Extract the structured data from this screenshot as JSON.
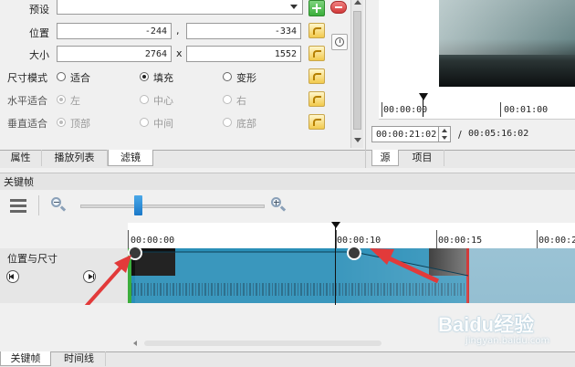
{
  "filter_panel": {
    "preset_label": "预设",
    "position_label": "位置",
    "position_x": "-244",
    "position_sep": ",",
    "position_y": "-334",
    "size_label": "大小",
    "size_w": "2764",
    "size_sep": "x",
    "size_h": "1552",
    "size_mode_label": "尺寸模式",
    "size_mode_options": [
      "适合",
      "填充",
      "变形"
    ],
    "size_mode_selected": "填充",
    "h_fit_label": "水平适合",
    "h_fit_options": [
      "左",
      "中心",
      "右"
    ],
    "v_fit_label": "垂直适合",
    "v_fit_options": [
      "顶部",
      "中间",
      "底部"
    ]
  },
  "left_tabs": [
    "属性",
    "播放列表",
    "滤镜"
  ],
  "left_tabs_active": "滤镜",
  "player": {
    "ruler_ticks": [
      "00:00:00",
      "00:01:00"
    ],
    "current_time": "00:00:21:02",
    "time_sep": "/",
    "total_time": "00:05:16:02",
    "tabs": [
      "源",
      "项目"
    ],
    "active_tab": "源"
  },
  "keyframes": {
    "title": "关键帧",
    "zoom_level": 0.45,
    "ruler_ticks": [
      "00:00:00",
      "00:00:10",
      "00:00:15",
      "00:00:2"
    ],
    "track_label": "位置与尺寸"
  },
  "bottom_tabs": [
    "关键帧",
    "时间线"
  ],
  "bottom_tabs_active": "关键帧",
  "watermark": "Baidu经验",
  "watermark_sub": "jingyan.baidu.com",
  "colors": {
    "clip": "#2a8fb8",
    "playhead": "#111111",
    "annotation_arrow": "#e23a3a",
    "add": "#3cae3c",
    "remove": "#d23a3a"
  }
}
